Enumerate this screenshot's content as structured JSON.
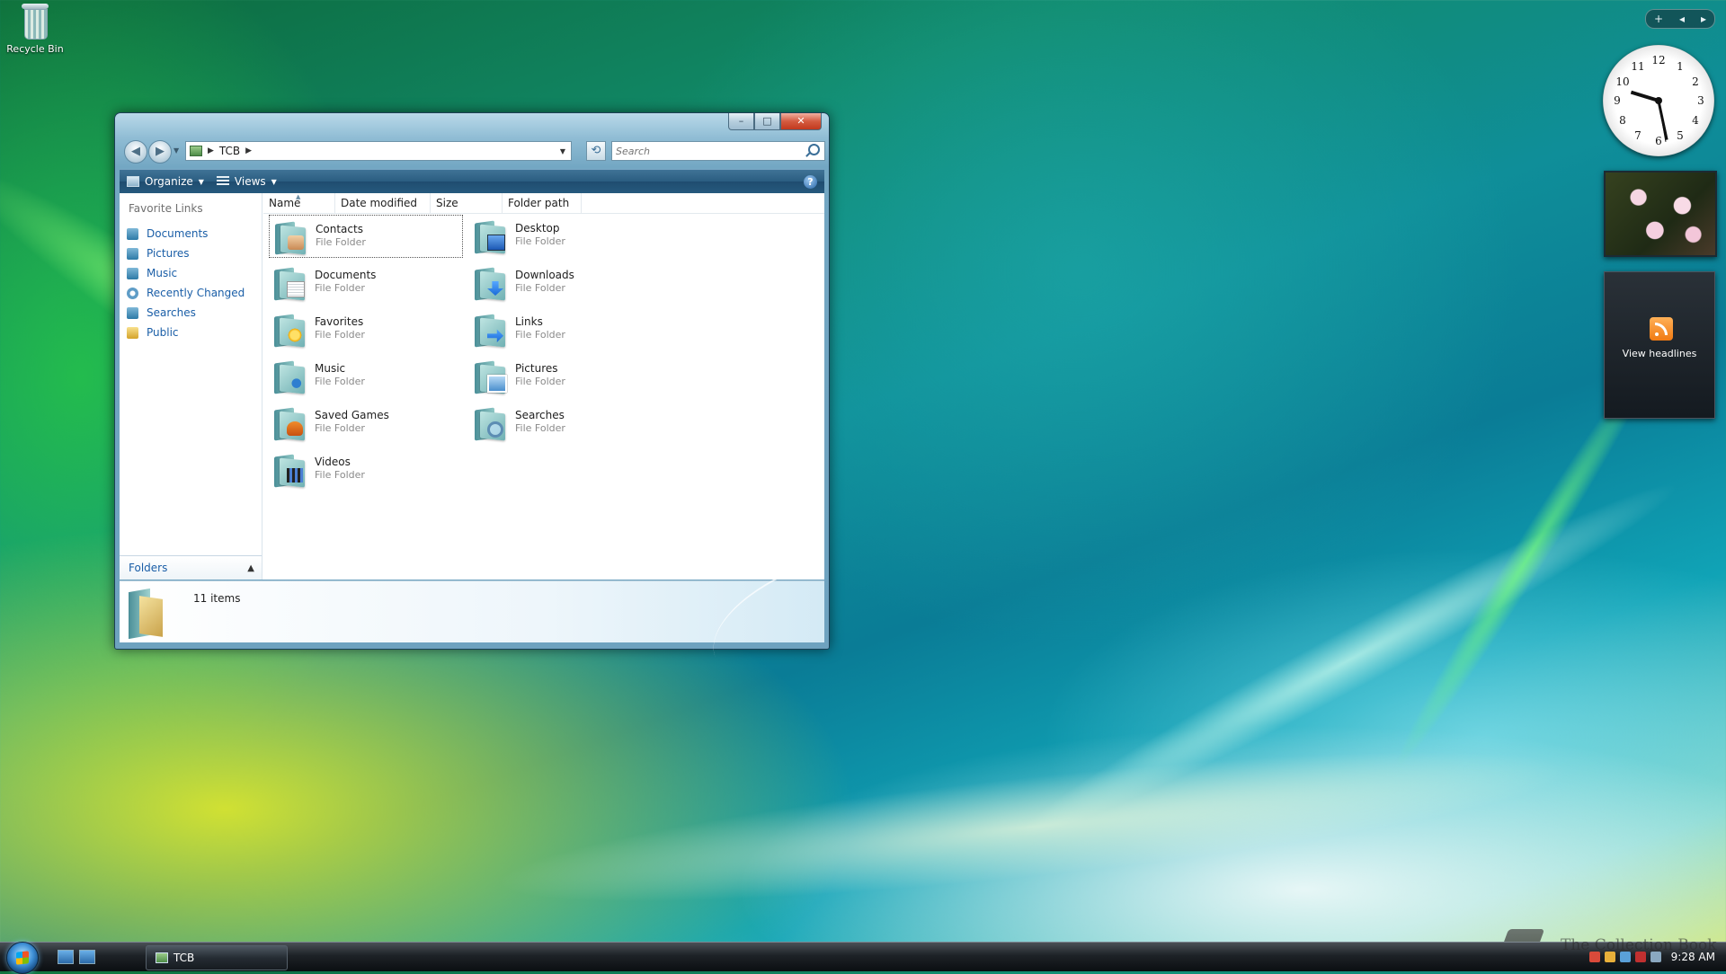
{
  "desktop": {
    "recycle_bin_label": "Recycle Bin"
  },
  "window": {
    "controls": {
      "minimize": "–",
      "maximize": "□",
      "close": "✕"
    },
    "nav": {
      "back": "◀",
      "forward": "▶"
    },
    "address": {
      "path": [
        "TCB"
      ]
    },
    "search": {
      "placeholder": "Search"
    },
    "commandbar": {
      "organize": "Organize",
      "views": "Views",
      "help": "?"
    },
    "navpane": {
      "title": "Favorite Links",
      "items": [
        "Documents",
        "Pictures",
        "Music",
        "Recently Changed",
        "Searches",
        "Public"
      ],
      "folders_label": "Folders"
    },
    "columns": [
      "Name",
      "Date modified",
      "Size",
      "Folder path"
    ],
    "files": [
      {
        "name": "Contacts",
        "type": "File Folder",
        "icon": "contacts-folder-icon"
      },
      {
        "name": "Desktop",
        "type": "File Folder",
        "icon": "desktop-folder-icon"
      },
      {
        "name": "Documents",
        "type": "File Folder",
        "icon": "documents-folder-icon"
      },
      {
        "name": "Downloads",
        "type": "File Folder",
        "icon": "downloads-folder-icon"
      },
      {
        "name": "Favorites",
        "type": "File Folder",
        "icon": "favorites-folder-icon"
      },
      {
        "name": "Links",
        "type": "File Folder",
        "icon": "links-folder-icon"
      },
      {
        "name": "Music",
        "type": "File Folder",
        "icon": "music-folder-icon"
      },
      {
        "name": "Pictures",
        "type": "File Folder",
        "icon": "pictures-folder-icon"
      },
      {
        "name": "Saved Games",
        "type": "File Folder",
        "icon": "saved-games-folder-icon"
      },
      {
        "name": "Searches",
        "type": "File Folder",
        "icon": "searches-folder-icon"
      },
      {
        "name": "Videos",
        "type": "File Folder",
        "icon": "videos-folder-icon"
      }
    ],
    "details": {
      "item_count": "11 items"
    }
  },
  "sidebar": {
    "controls": {
      "add": "+",
      "prev": "◂",
      "next": "▸"
    },
    "clock_numbers": [
      "12",
      "1",
      "2",
      "3",
      "4",
      "5",
      "6",
      "7",
      "8",
      "9",
      "10",
      "11"
    ],
    "feeds_label": "View headlines"
  },
  "taskbar": {
    "task_label": "TCB",
    "time": "9:28 AM",
    "watermark": "The Collection Book"
  }
}
